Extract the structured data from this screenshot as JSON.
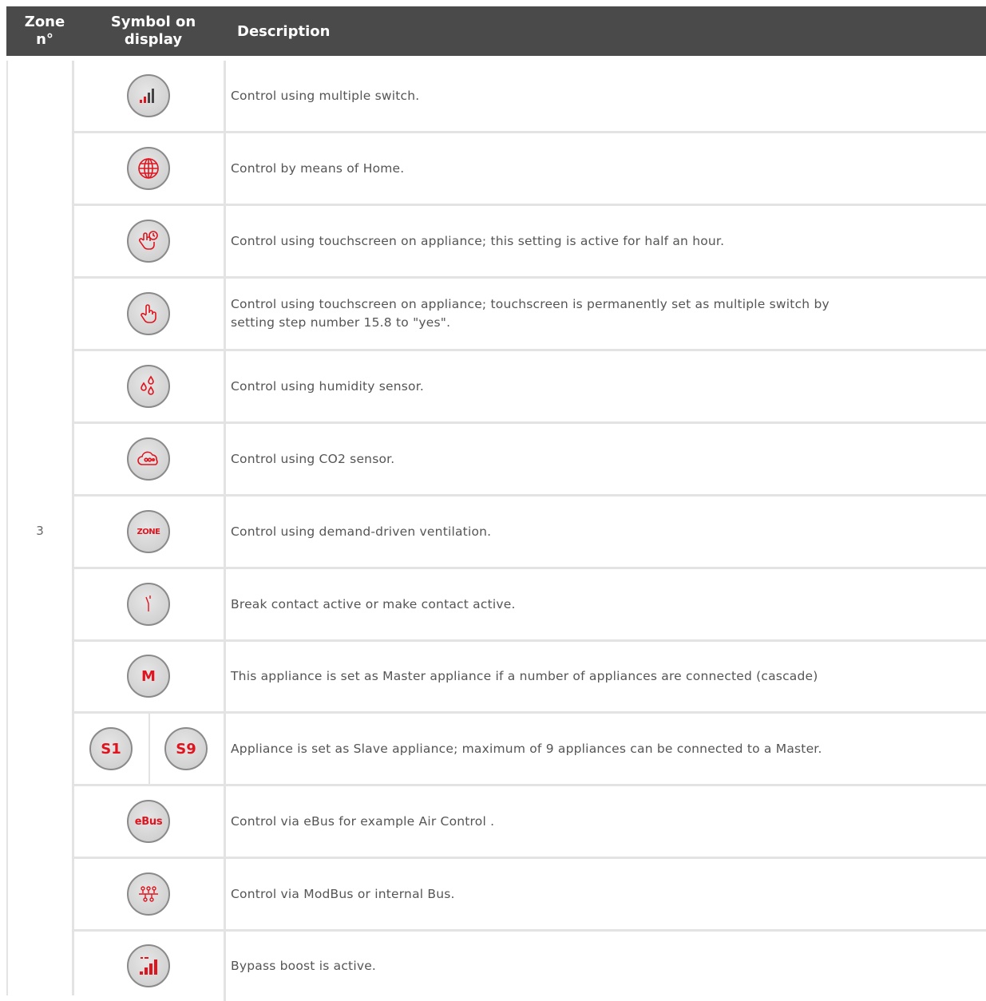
{
  "header": {
    "zone": "Zone\nn°",
    "symbol": "Symbol on\ndisplay",
    "description": "Description"
  },
  "zone_number": "3",
  "accent_color": "#e0141e",
  "rows": [
    {
      "icon": "signal-bars-icon",
      "description": "Control using multiple switch."
    },
    {
      "icon": "globe-icon",
      "description": "Control by means of Home."
    },
    {
      "icon": "touch-hand-timer-icon",
      "description": "Control using touchscreen on appliance; this setting is active for half an hour."
    },
    {
      "icon": "touch-hand-icon",
      "description": "Control using touchscreen on appliance; touchscreen is permanently set as multiple switch by setting step number 15.8 to \"yes\"."
    },
    {
      "icon": "humidity-drops-icon",
      "description": "Control using humidity sensor."
    },
    {
      "icon": "co2-cloud-icon",
      "description": "Control using CO2 sensor."
    },
    {
      "icon": "zone-icon",
      "icon_text": "ZONE",
      "description": "Control using demand-driven ventilation."
    },
    {
      "icon": "contact-switch-icon",
      "description": "Break contact active or make contact active."
    },
    {
      "icon": "master-icon",
      "icon_text": "M",
      "description": "This appliance is set as Master appliance if a number of appliances are connected (cascade)"
    },
    {
      "icon": "slave-icon",
      "icon_text": "S1",
      "icon_text_2": "S9",
      "description": "Appliance is set as Slave appliance; maximum of 9 appliances can be connected to a Master."
    },
    {
      "icon": "ebus-icon",
      "icon_text": "eBus",
      "description": "Control via eBus for example Air Control ."
    },
    {
      "icon": "modbus-icon",
      "description": "Control via ModBus or internal Bus."
    },
    {
      "icon": "bypass-boost-icon",
      "description": "Bypass boost is active."
    }
  ]
}
